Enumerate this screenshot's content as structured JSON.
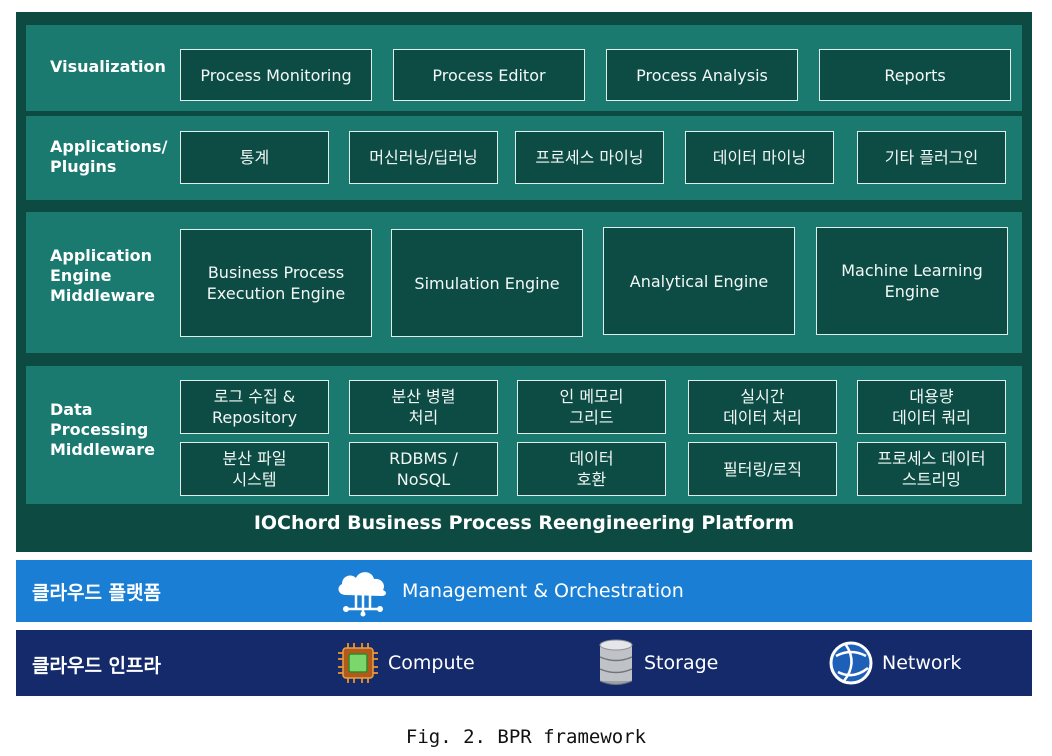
{
  "platform": {
    "title": "IOChord Business Process Reengineering Platform",
    "visualization": {
      "label": "Visualization",
      "items": [
        "Process Monitoring",
        "Process Editor",
        "Process Analysis",
        "Reports"
      ]
    },
    "applications": {
      "label": "Applications/\nPlugins",
      "items": [
        "통계",
        "머신러닝/딥러닝",
        "프로세스 마이닝",
        "데이터 마이닝",
        "기타 플러그인"
      ]
    },
    "engine": {
      "label": "Application\nEngine\nMiddleware",
      "items": [
        "Business Process\nExecution Engine",
        "Simulation Engine",
        "Analytical Engine",
        "Machine Learning\nEngine"
      ]
    },
    "data": {
      "label": "Data\nProcessing\nMiddleware",
      "row1": [
        "로그 수집 &\nRepository",
        "분산 병렬\n처리",
        "인 메모리\n그리드",
        "실시간\n데이터 처리",
        "대용량\n데이터 쿼리"
      ],
      "row2": [
        "분산 파일\n시스템",
        "RDBMS /\nNoSQL",
        "데이터\n호환",
        "필터링/로직",
        "프로세스 데이터\n스트리밍"
      ]
    }
  },
  "cloud_platform": {
    "label": "클라우드 플랫폼",
    "item": "Management & Orchestration",
    "icon": "cloud-network-icon",
    "color": "#1a7fd4"
  },
  "cloud_infra": {
    "label": "클라우드 인프라",
    "items": [
      {
        "label": "Compute",
        "icon": "chip-icon"
      },
      {
        "label": "Storage",
        "icon": "database-icon"
      },
      {
        "label": "Network",
        "icon": "globe-icon"
      }
    ],
    "color": "#142a6b"
  },
  "caption": "Fig. 2. BPR framework",
  "colors": {
    "platform_bg": "#0c4a42",
    "layer_bg": "#1b7a70",
    "box_bg": "#0d4c44"
  }
}
